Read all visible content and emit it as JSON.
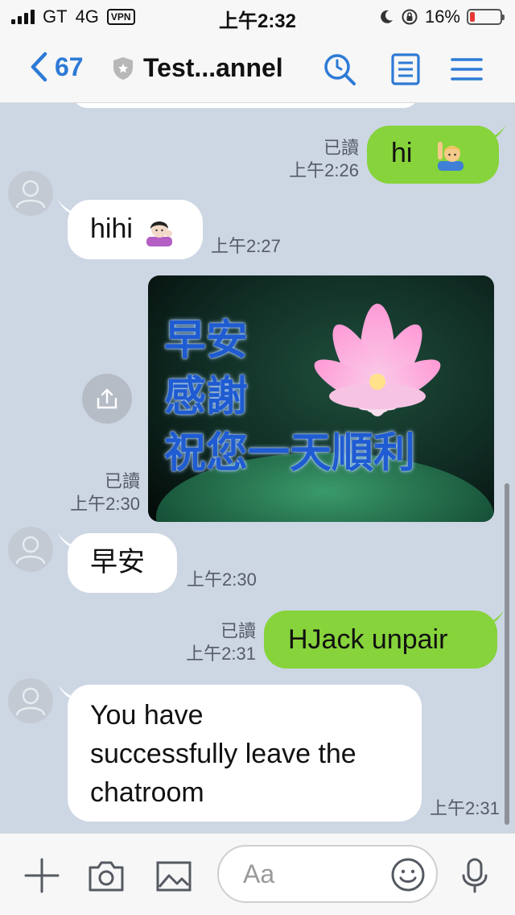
{
  "status_bar": {
    "carrier": "GT",
    "network": "4G",
    "vpn": "VPN",
    "time": "上午2:32",
    "battery": "16%",
    "battery_level": 0.16
  },
  "header": {
    "back_count": "67",
    "title": "Test...annel",
    "icons": [
      "chevron-left-icon",
      "shield-icon",
      "search-icon",
      "notes-icon",
      "menu-icon"
    ]
  },
  "messages": [
    {
      "direction": "out",
      "text": "hi",
      "emoji": "raising-hand-emoji",
      "read": "已讀",
      "time": "上午2:26"
    },
    {
      "direction": "in",
      "text": "hihi",
      "emoji": "tipping-hand-emoji",
      "time": "上午2:27"
    },
    {
      "direction": "in",
      "type": "image",
      "image_text": [
        "早安",
        "感謝",
        "祝您一天順利"
      ],
      "read": "已讀",
      "time": "上午2:30"
    },
    {
      "direction": "in",
      "text": "早安",
      "time": "上午2:30"
    },
    {
      "direction": "out",
      "text": "HJack unpair",
      "read": "已讀",
      "time": "上午2:31"
    },
    {
      "direction": "in",
      "text_lines": [
        "You have",
        "successfully leave the",
        "chatroom"
      ],
      "time": "上午2:31"
    }
  ],
  "input_bar": {
    "placeholder": "Aa",
    "icons": [
      "plus-icon",
      "camera-icon",
      "image-icon",
      "emoji-icon",
      "microphone-icon"
    ]
  },
  "colors": {
    "chat_background": "#cdd6e3",
    "outgoing_bubble": "#86d33b",
    "incoming_bubble": "#ffffff",
    "accent": "#2d7ad6",
    "battery_low": "#e53935"
  }
}
